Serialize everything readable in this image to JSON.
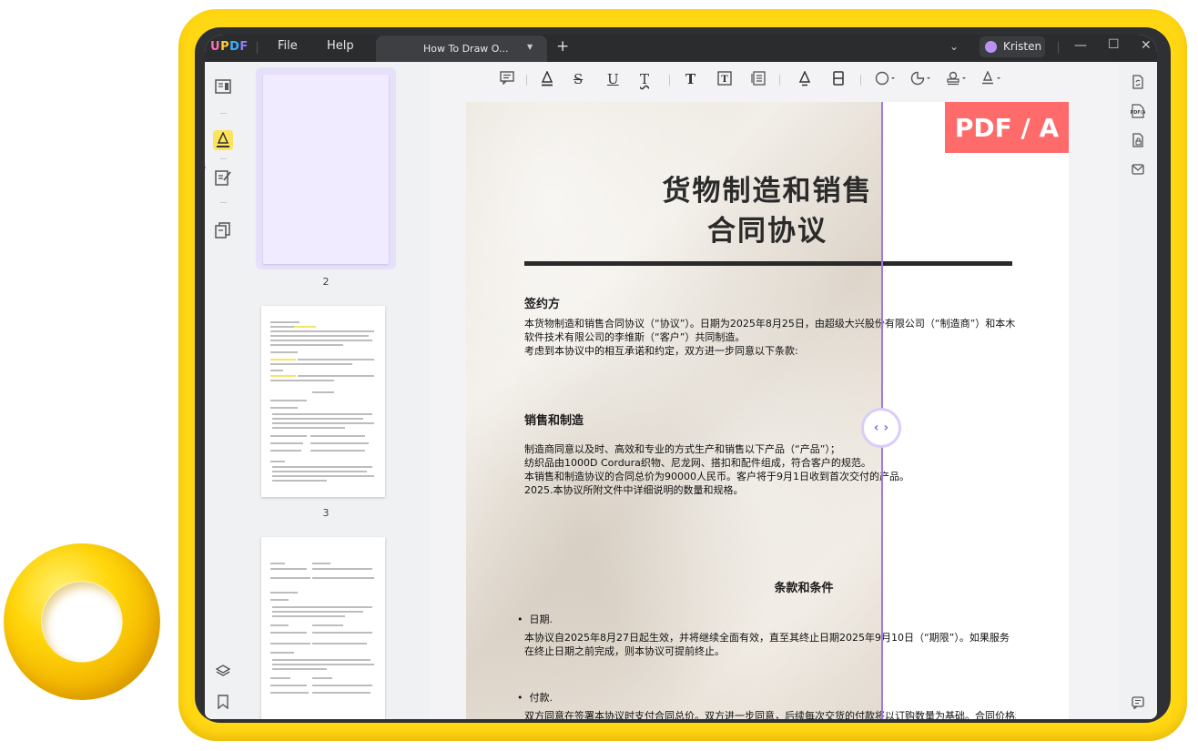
{
  "app": {
    "logo": "UPDF",
    "menu": [
      "File",
      "Help"
    ],
    "tab_title": "How To Draw O...",
    "new_tab": "+",
    "user_name": "Kristen"
  },
  "thumbnails": {
    "pages": [
      "2",
      "3"
    ]
  },
  "document": {
    "badge": "PDF / A",
    "title_line1": "货物制造和销售",
    "title_line2": "合同协议",
    "section1_heading": "签约方",
    "section1_para": "本货物制造和销售合同协议（“协议”）。日期为2025年8月25日，由超级大兴股份有限公司（“制造商”）和本木软件技术有限公司的李维斯（“客户”）共同制造。",
    "section1_para2": "考虑到本协议中的相互承诺和约定，双方进一步同意以下条款:",
    "section2_heading": "销售和制造",
    "section2_line1": "制造商同意以及时、高效和专业的方式生产和销售以下产品（“产品”）；",
    "section2_line2": "纺织品由1000D Cordura织物、尼龙网、搭扣和配件组成，符合客户的规范。",
    "section2_line3": "本销售和制造协议的合同总价为90000人民币。客户将于9月1日收到首次交付的产品。",
    "section2_line4": "2025.本协议所附文件中详细说明的数量和规格。",
    "section3_heading": "条款和条件",
    "bullet1": "日期.",
    "bullet1_para": "本协议自2025年8月27日起生效，并将继续全面有效，直至其终止日期2025年9月10日（“期限”）。如果服务在终止日期之前完成，则本协议可提前终止。",
    "bullet2": "付款.",
    "bullet2_para": "双方同意在签署本协议时支付合同总价。双方进一步同意，后续每次交货的付款将以订购数量为基础。合同价格和"
  },
  "colors": {
    "frame": "#ffd713",
    "accent": "#8a69e6",
    "badge": "#ff6b6b"
  },
  "icons": {
    "left_rail": [
      "reader-icon",
      "comment-icon",
      "edit-icon",
      "organize-icon",
      "layers-icon",
      "bookmark-icon"
    ],
    "right_rail": [
      "convert-icon",
      "pdfa-icon",
      "protect-icon",
      "share-icon",
      "chat-icon"
    ]
  }
}
